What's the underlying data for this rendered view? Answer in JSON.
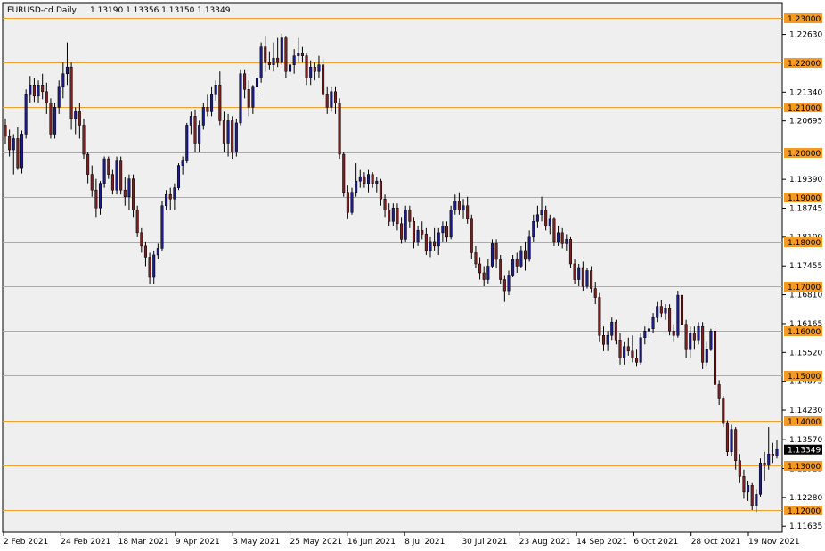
{
  "header": {
    "symbol": "EURUSD-cd",
    "timeframe": "Daily",
    "ohlc": "1.13190 1.13356 1.13150 1.13349"
  },
  "colors": {
    "background": "#ffffff",
    "plot_background": "#efefef",
    "level_line": "#f0a030",
    "level_badge": "#f59a23",
    "bull_candle": "#1c1c8c",
    "bear_candle": "#7a2020",
    "wick": "#000000",
    "current_price_badge": "#000000"
  },
  "chart_data": {
    "type": "candlestick",
    "title": "",
    "ylim": [
      1.1158,
      1.231
    ],
    "y_ticks_plain": [
      1.2263,
      1.2134,
      1.20695,
      1.1939,
      1.18745,
      1.181,
      1.17455,
      1.1681,
      1.16165,
      1.1552,
      1.14875,
      1.1423,
      1.1357,
      1.12925,
      1.1228,
      1.11635
    ],
    "levels": [
      1.23,
      1.22,
      1.21,
      1.2,
      1.19,
      1.18,
      1.17,
      1.16,
      1.15,
      1.14,
      1.13,
      1.12
    ],
    "current_price": 1.13349,
    "x_labels": [
      "2 Feb 2021",
      "24 Feb 2021",
      "18 Mar 2021",
      "9 Apr 2021",
      "3 May 2021",
      "25 May 2021",
      "16 Jun 2021",
      "8 Jul 2021",
      "30 Jul 2021",
      "23 Aug 2021",
      "14 Sep 2021",
      "6 Oct 2021",
      "28 Oct 2021",
      "19 Nov 2021"
    ],
    "candles": [
      [
        1.206,
        1.2075,
        1.2018,
        1.2035
      ],
      [
        1.2035,
        1.205,
        1.199,
        1.2005
      ],
      [
        1.2005,
        1.204,
        1.195,
        1.203
      ],
      [
        1.203,
        1.2055,
        1.196,
        1.1965
      ],
      [
        1.1965,
        1.2048,
        1.1952,
        1.204
      ],
      [
        1.204,
        1.214,
        1.203,
        1.213
      ],
      [
        1.213,
        1.217,
        1.211,
        1.215
      ],
      [
        1.215,
        1.2165,
        1.2112,
        1.2125
      ],
      [
        1.2125,
        1.216,
        1.211,
        1.215
      ],
      [
        1.215,
        1.2175,
        1.2118,
        1.2135
      ],
      [
        1.2135,
        1.2155,
        1.2085,
        1.211
      ],
      [
        1.211,
        1.212,
        1.203,
        1.204
      ],
      [
        1.204,
        1.211,
        1.203,
        1.21
      ],
      [
        1.21,
        1.216,
        1.2085,
        1.2145
      ],
      [
        1.2145,
        1.22,
        1.212,
        1.2175
      ],
      [
        1.2175,
        1.2245,
        1.215,
        1.219
      ],
      [
        1.219,
        1.22,
        1.205,
        1.2075
      ],
      [
        1.2075,
        1.21,
        1.204,
        1.209
      ],
      [
        1.209,
        1.211,
        1.203,
        1.206
      ],
      [
        1.206,
        1.2075,
        1.1985,
        1.1995
      ],
      [
        1.1995,
        1.2,
        1.193,
        1.195
      ],
      [
        1.195,
        1.197,
        1.19,
        1.1915
      ],
      [
        1.1915,
        1.194,
        1.1855,
        1.1875
      ],
      [
        1.1875,
        1.1935,
        1.186,
        1.193
      ],
      [
        1.193,
        1.199,
        1.192,
        1.1985
      ],
      [
        1.1985,
        1.199,
        1.194,
        1.195
      ],
      [
        1.195,
        1.196,
        1.1905,
        1.1915
      ],
      [
        1.1915,
        1.199,
        1.1905,
        1.198
      ],
      [
        1.198,
        1.199,
        1.1905,
        1.1915
      ],
      [
        1.1915,
        1.1945,
        1.188,
        1.19
      ],
      [
        1.19,
        1.195,
        1.187,
        1.194
      ],
      [
        1.194,
        1.195,
        1.1855,
        1.187
      ],
      [
        1.187,
        1.188,
        1.181,
        1.182
      ],
      [
        1.182,
        1.183,
        1.1775,
        1.179
      ],
      [
        1.179,
        1.18,
        1.1745,
        1.1765
      ],
      [
        1.1765,
        1.1775,
        1.1705,
        1.172
      ],
      [
        1.172,
        1.178,
        1.1705,
        1.177
      ],
      [
        1.177,
        1.1795,
        1.176,
        1.1785
      ],
      [
        1.1785,
        1.189,
        1.178,
        1.188
      ],
      [
        1.188,
        1.1915,
        1.187,
        1.1905
      ],
      [
        1.1905,
        1.192,
        1.187,
        1.1895
      ],
      [
        1.1895,
        1.193,
        1.187,
        1.192
      ],
      [
        1.192,
        1.1975,
        1.1915,
        1.197
      ],
      [
        1.197,
        1.199,
        1.195,
        1.198
      ],
      [
        1.198,
        1.2065,
        1.1975,
        1.206
      ],
      [
        1.206,
        1.209,
        1.204,
        1.208
      ],
      [
        1.208,
        1.2095,
        1.2,
        1.202
      ],
      [
        1.202,
        1.207,
        1.2,
        1.206
      ],
      [
        1.206,
        1.211,
        1.205,
        1.21
      ],
      [
        1.21,
        1.213,
        1.208,
        1.209
      ],
      [
        1.209,
        1.2145,
        1.208,
        1.213
      ],
      [
        1.213,
        1.216,
        1.2115,
        1.215
      ],
      [
        1.215,
        1.218,
        1.206,
        1.207
      ],
      [
        1.207,
        1.209,
        1.2,
        1.202
      ],
      [
        1.202,
        1.2085,
        1.199,
        1.207
      ],
      [
        1.207,
        1.208,
        1.1985,
        1.2
      ],
      [
        1.2,
        1.2075,
        1.199,
        1.2065
      ],
      [
        1.2065,
        1.2185,
        1.206,
        1.2175
      ],
      [
        1.2175,
        1.2185,
        1.212,
        1.214
      ],
      [
        1.214,
        1.216,
        1.208,
        1.21
      ],
      [
        1.21,
        1.215,
        1.2085,
        1.2145
      ],
      [
        1.2145,
        1.2175,
        1.2125,
        1.2165
      ],
      [
        1.2165,
        1.2245,
        1.2155,
        1.2235
      ],
      [
        1.2235,
        1.226,
        1.218,
        1.22
      ],
      [
        1.22,
        1.2225,
        1.2185,
        1.2195
      ],
      [
        1.2195,
        1.2245,
        1.218,
        1.221
      ],
      [
        1.221,
        1.2255,
        1.219,
        1.22
      ],
      [
        1.22,
        1.2265,
        1.2195,
        1.2255
      ],
      [
        1.2255,
        1.226,
        1.2165,
        1.218
      ],
      [
        1.218,
        1.2215,
        1.217,
        1.2195
      ],
      [
        1.2195,
        1.223,
        1.2175,
        1.2215
      ],
      [
        1.2215,
        1.2255,
        1.22,
        1.222
      ],
      [
        1.222,
        1.2235,
        1.22,
        1.2215
      ],
      [
        1.2215,
        1.222,
        1.215,
        1.2165
      ],
      [
        1.2165,
        1.2205,
        1.215,
        1.219
      ],
      [
        1.219,
        1.22,
        1.216,
        1.218
      ],
      [
        1.218,
        1.2215,
        1.2165,
        1.2195
      ],
      [
        1.2195,
        1.221,
        1.212,
        1.213
      ],
      [
        1.213,
        1.2145,
        1.2085,
        1.21
      ],
      [
        1.21,
        1.2145,
        1.209,
        1.2135
      ],
      [
        1.2135,
        1.2145,
        1.2085,
        1.211
      ],
      [
        1.211,
        1.212,
        1.1985,
        1.1995
      ],
      [
        1.1995,
        1.2,
        1.19,
        1.191
      ],
      [
        1.191,
        1.1925,
        1.185,
        1.1865
      ],
      [
        1.1865,
        1.192,
        1.186,
        1.191
      ],
      [
        1.191,
        1.1975,
        1.19,
        1.1935
      ],
      [
        1.1935,
        1.196,
        1.192,
        1.1945
      ],
      [
        1.1945,
        1.1955,
        1.192,
        1.193
      ],
      [
        1.193,
        1.196,
        1.191,
        1.195
      ],
      [
        1.195,
        1.1955,
        1.192,
        1.193
      ],
      [
        1.193,
        1.1945,
        1.191,
        1.1935
      ],
      [
        1.1935,
        1.194,
        1.188,
        1.1895
      ],
      [
        1.1895,
        1.1905,
        1.1855,
        1.187
      ],
      [
        1.187,
        1.1885,
        1.1835,
        1.1845
      ],
      [
        1.1845,
        1.1885,
        1.1835,
        1.1875
      ],
      [
        1.1875,
        1.1885,
        1.1825,
        1.184
      ],
      [
        1.184,
        1.1855,
        1.1795,
        1.1805
      ],
      [
        1.1805,
        1.188,
        1.18,
        1.187
      ],
      [
        1.187,
        1.188,
        1.183,
        1.1845
      ],
      [
        1.1845,
        1.1855,
        1.1785,
        1.18
      ],
      [
        1.18,
        1.1835,
        1.179,
        1.1825
      ],
      [
        1.1825,
        1.1845,
        1.1805,
        1.1815
      ],
      [
        1.1815,
        1.183,
        1.177,
        1.178
      ],
      [
        1.178,
        1.181,
        1.1765,
        1.18
      ],
      [
        1.18,
        1.183,
        1.178,
        1.179
      ],
      [
        1.179,
        1.183,
        1.177,
        1.182
      ],
      [
        1.182,
        1.1845,
        1.18,
        1.1835
      ],
      [
        1.1835,
        1.1845,
        1.18,
        1.181
      ],
      [
        1.181,
        1.188,
        1.1805,
        1.187
      ],
      [
        1.187,
        1.1905,
        1.186,
        1.189
      ],
      [
        1.189,
        1.191,
        1.186,
        1.187
      ],
      [
        1.187,
        1.1895,
        1.185,
        1.188
      ],
      [
        1.188,
        1.19,
        1.184,
        1.185
      ],
      [
        1.185,
        1.186,
        1.176,
        1.1775
      ],
      [
        1.1775,
        1.179,
        1.174,
        1.175
      ],
      [
        1.175,
        1.1765,
        1.1715,
        1.173
      ],
      [
        1.173,
        1.1745,
        1.17,
        1.1715
      ],
      [
        1.1715,
        1.176,
        1.1705,
        1.1745
      ],
      [
        1.1745,
        1.1805,
        1.174,
        1.1795
      ],
      [
        1.1795,
        1.1805,
        1.174,
        1.176
      ],
      [
        1.176,
        1.177,
        1.1705,
        1.1715
      ],
      [
        1.1715,
        1.1725,
        1.1665,
        1.169
      ],
      [
        1.169,
        1.1735,
        1.168,
        1.1725
      ],
      [
        1.1725,
        1.177,
        1.172,
        1.176
      ],
      [
        1.176,
        1.1775,
        1.173,
        1.1745
      ],
      [
        1.1745,
        1.179,
        1.174,
        1.178
      ],
      [
        1.178,
        1.18,
        1.1735,
        1.176
      ],
      [
        1.176,
        1.1825,
        1.1755,
        1.181
      ],
      [
        1.181,
        1.186,
        1.18,
        1.1845
      ],
      [
        1.1845,
        1.188,
        1.183,
        1.186
      ],
      [
        1.186,
        1.19,
        1.1845,
        1.187
      ],
      [
        1.187,
        1.188,
        1.1825,
        1.1835
      ],
      [
        1.1835,
        1.186,
        1.1815,
        1.185
      ],
      [
        1.185,
        1.1855,
        1.179,
        1.18
      ],
      [
        1.18,
        1.1835,
        1.179,
        1.182
      ],
      [
        1.182,
        1.183,
        1.1785,
        1.1795
      ],
      [
        1.1795,
        1.1815,
        1.178,
        1.1805
      ],
      [
        1.1805,
        1.181,
        1.174,
        1.175
      ],
      [
        1.175,
        1.176,
        1.1705,
        1.1715
      ],
      [
        1.1715,
        1.175,
        1.17,
        1.174
      ],
      [
        1.174,
        1.1755,
        1.169,
        1.17
      ],
      [
        1.17,
        1.174,
        1.1695,
        1.1735
      ],
      [
        1.1735,
        1.1745,
        1.1685,
        1.1695
      ],
      [
        1.1695,
        1.171,
        1.166,
        1.1675
      ],
      [
        1.1675,
        1.1685,
        1.1575,
        1.159
      ],
      [
        1.159,
        1.161,
        1.1555,
        1.157
      ],
      [
        1.157,
        1.16,
        1.1555,
        1.159
      ],
      [
        1.159,
        1.163,
        1.158,
        1.162
      ],
      [
        1.162,
        1.1625,
        1.157,
        1.158
      ],
      [
        1.158,
        1.1595,
        1.1525,
        1.154
      ],
      [
        1.154,
        1.1575,
        1.1525,
        1.1565
      ],
      [
        1.1565,
        1.1585,
        1.1545,
        1.1555
      ],
      [
        1.1555,
        1.159,
        1.153,
        1.154
      ],
      [
        1.154,
        1.156,
        1.152,
        1.153
      ],
      [
        1.153,
        1.1595,
        1.1525,
        1.1585
      ],
      [
        1.1585,
        1.161,
        1.157,
        1.16
      ],
      [
        1.16,
        1.162,
        1.1585,
        1.1605
      ],
      [
        1.1605,
        1.164,
        1.1595,
        1.163
      ],
      [
        1.163,
        1.1665,
        1.162,
        1.1655
      ],
      [
        1.1655,
        1.167,
        1.163,
        1.164
      ],
      [
        1.164,
        1.166,
        1.1625,
        1.165
      ],
      [
        1.165,
        1.166,
        1.159,
        1.16
      ],
      [
        1.16,
        1.1615,
        1.1575,
        1.159
      ],
      [
        1.159,
        1.169,
        1.1585,
        1.168
      ],
      [
        1.168,
        1.1695,
        1.16,
        1.1615
      ],
      [
        1.1615,
        1.1625,
        1.154,
        1.156
      ],
      [
        1.156,
        1.161,
        1.154,
        1.1595
      ],
      [
        1.1595,
        1.161,
        1.156,
        1.158
      ],
      [
        1.158,
        1.162,
        1.157,
        1.161
      ],
      [
        1.161,
        1.162,
        1.1515,
        1.153
      ],
      [
        1.153,
        1.1575,
        1.152,
        1.156
      ],
      [
        1.156,
        1.1605,
        1.1555,
        1.16
      ],
      [
        1.16,
        1.161,
        1.147,
        1.148
      ],
      [
        1.148,
        1.149,
        1.1435,
        1.145
      ],
      [
        1.145,
        1.1455,
        1.1385,
        1.1395
      ],
      [
        1.1395,
        1.14,
        1.132,
        1.133
      ],
      [
        1.133,
        1.139,
        1.132,
        1.138
      ],
      [
        1.138,
        1.1385,
        1.129,
        1.131
      ],
      [
        1.131,
        1.1325,
        1.126,
        1.1275
      ],
      [
        1.1275,
        1.129,
        1.1225,
        1.124
      ],
      [
        1.124,
        1.1265,
        1.122,
        1.1255
      ],
      [
        1.1255,
        1.126,
        1.12,
        1.121
      ],
      [
        1.121,
        1.1245,
        1.1195,
        1.1235
      ],
      [
        1.1235,
        1.1315,
        1.123,
        1.1305
      ],
      [
        1.1305,
        1.133,
        1.1265,
        1.13
      ],
      [
        1.13,
        1.1385,
        1.129,
        1.1325
      ],
      [
        1.1325,
        1.135,
        1.1305,
        1.132
      ],
      [
        1.132,
        1.1356,
        1.1315,
        1.1335
      ]
    ]
  }
}
